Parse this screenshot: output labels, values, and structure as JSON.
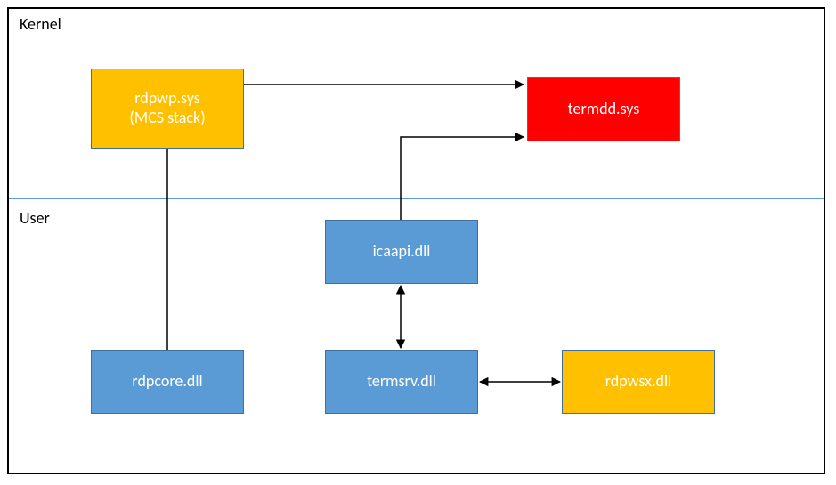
{
  "sections": {
    "kernel": "Kernel",
    "user": "User"
  },
  "nodes": {
    "rdpwp": {
      "line1": "rdpwp.sys",
      "line2": "(MCS stack)"
    },
    "termdd": {
      "label": "termdd.sys"
    },
    "icaapi": {
      "label": "icaapi.dll"
    },
    "rdpcore": {
      "label": "rdpcore.dll"
    },
    "termsrv": {
      "label": "termsrv.dll"
    },
    "rdpwsx": {
      "label": "rdpwsx.dll"
    }
  },
  "colors": {
    "blue": "#5b9bd5",
    "amber": "#ffc000",
    "red": "#ff0000",
    "edge": "#4170a0",
    "arrow": "#000000"
  },
  "chart_data": {
    "type": "diagram",
    "title": "",
    "sections": [
      {
        "id": "kernel",
        "label": "Kernel"
      },
      {
        "id": "user",
        "label": "User"
      }
    ],
    "nodes": [
      {
        "id": "rdpwp",
        "label": "rdpwp.sys (MCS stack)",
        "section": "kernel",
        "color": "amber"
      },
      {
        "id": "termdd",
        "label": "termdd.sys",
        "section": "kernel",
        "color": "red"
      },
      {
        "id": "icaapi",
        "label": "icaapi.dll",
        "section": "user",
        "color": "blue"
      },
      {
        "id": "rdpcore",
        "label": "rdpcore.dll",
        "section": "user",
        "color": "blue"
      },
      {
        "id": "termsrv",
        "label": "termsrv.dll",
        "section": "user",
        "color": "blue"
      },
      {
        "id": "rdpwsx",
        "label": "rdpwsx.dll",
        "section": "user",
        "color": "amber"
      }
    ],
    "edges": [
      {
        "from": "rdpwp",
        "to": "termdd",
        "directed": true,
        "bidirectional": false
      },
      {
        "from": "icaapi",
        "to": "termdd",
        "directed": true,
        "bidirectional": false
      },
      {
        "from": "rdpwp",
        "to": "rdpcore",
        "directed": false,
        "bidirectional": false
      },
      {
        "from": "icaapi",
        "to": "termsrv",
        "directed": true,
        "bidirectional": true
      },
      {
        "from": "termsrv",
        "to": "rdpwsx",
        "directed": true,
        "bidirectional": true
      }
    ]
  }
}
